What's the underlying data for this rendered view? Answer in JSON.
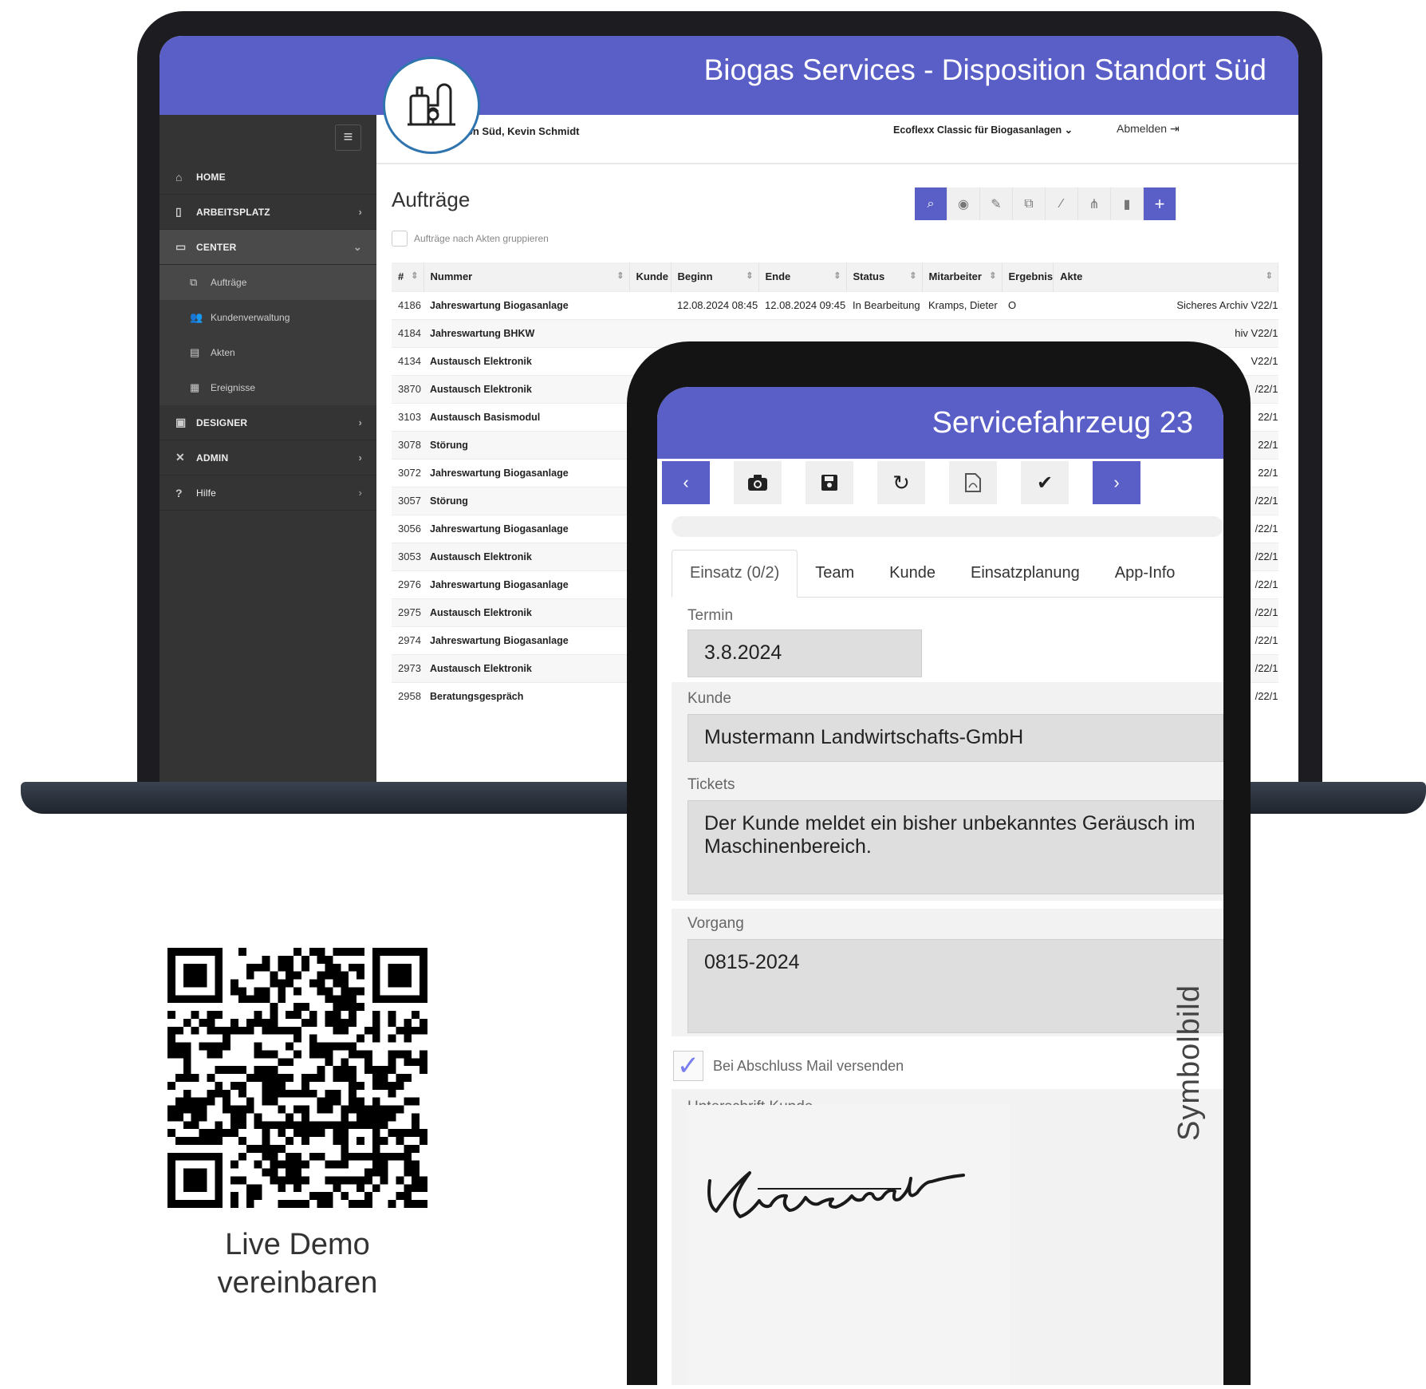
{
  "laptop": {
    "banner_title": "Biogas Services - Disposition Standort Süd",
    "user_info": "Disposition Süd, Kevin Schmidt",
    "product_selector": "Ecoflexx Classic für Biogasanlagen ⌄",
    "logout_label": "Abmelden",
    "sidebar": {
      "items": [
        {
          "label": "HOME",
          "icon": "home-icon"
        },
        {
          "label": "ARBEITSPLATZ",
          "icon": "mobile-icon"
        },
        {
          "label": "CENTER",
          "icon": "monitor-icon"
        },
        {
          "label": "Aufträge",
          "icon": "orders-icon"
        },
        {
          "label": "Kundenverwaltung",
          "icon": "users-icon"
        },
        {
          "label": "Akten",
          "icon": "archive-icon"
        },
        {
          "label": "Ereignisse",
          "icon": "events-icon"
        },
        {
          "label": "DESIGNER",
          "icon": "designer-icon"
        },
        {
          "label": "ADMIN",
          "icon": "tools-icon"
        },
        {
          "label": "Hilfe",
          "icon": "help-icon"
        }
      ]
    },
    "page_title": "Aufträge",
    "group_label": "Aufträge nach Akten gruppieren",
    "table": {
      "headers": [
        "#",
        "Nummer",
        "Kunde",
        "Beginn",
        "Ende",
        "Status",
        "Mitarbeiter",
        "Ergebnis",
        "Akte"
      ],
      "rows": [
        {
          "id": "4186",
          "title": "Jahreswartung Biogasanlage",
          "kunde": "",
          "beginn": "12.08.2024 08:45",
          "ende": "12.08.2024 09:45",
          "status": "In Bearbeitung",
          "mitarbeiter": "Kramps, Dieter",
          "ergebnis": "O",
          "akte": "Sicheres Archiv V22/1"
        },
        {
          "id": "4184",
          "title": "Jahreswartung BHKW",
          "akte": "hiv V22/1"
        },
        {
          "id": "4134",
          "title": "Austausch Elektronik",
          "akte": "V22/1"
        },
        {
          "id": "3870",
          "title": "Austausch Elektronik",
          "akte": "/22/1"
        },
        {
          "id": "3103",
          "title": "Austausch Basismodul",
          "akte": "22/1"
        },
        {
          "id": "3078",
          "title": "Störung",
          "akte": "22/1"
        },
        {
          "id": "3072",
          "title": "Jahreswartung Biogasanlage",
          "akte": "22/1"
        },
        {
          "id": "3057",
          "title": "Störung",
          "akte": "/22/1"
        },
        {
          "id": "3056",
          "title": "Jahreswartung Biogasanlage",
          "akte": "/22/1"
        },
        {
          "id": "3053",
          "title": "Austausch Elektronik",
          "akte": "/22/1"
        },
        {
          "id": "2976",
          "title": "Jahreswartung Biogasanlage",
          "akte": "/22/1"
        },
        {
          "id": "2975",
          "title": "Austausch Elektronik",
          "akte": "/22/1"
        },
        {
          "id": "2974",
          "title": "Jahreswartung Biogasanlage",
          "akte": "/22/1"
        },
        {
          "id": "2973",
          "title": "Austausch Elektronik",
          "akte": "/22/1"
        },
        {
          "id": "2958",
          "title": "Beratungsgespräch",
          "akte": "/22/1"
        }
      ]
    }
  },
  "tablet": {
    "title": "Servicefahrzeug 23",
    "tabs": [
      "Einsatz (0/2)",
      "Team",
      "Kunde",
      "Einsatzplanung",
      "App-Info"
    ],
    "termin_label": "Termin",
    "termin_value": "3.8.2024",
    "kunde_label": "Kunde",
    "kunde_value": "Mustermann Landwirtschafts-GmbH",
    "tickets_label": "Tickets",
    "tickets_value": "Der Kunde meldet ein bisher unbekanntes Geräusch im Maschinenbereich.",
    "vorgang_label": "Vorgang",
    "vorgang_value": "0815-2024",
    "mail_label": "Bei Abschluss Mail versenden",
    "mail_checked": true,
    "signature_label": "Unterschrift Kunde",
    "signature_text": "Unterschrift",
    "symbolbild": "Symbolbild"
  },
  "qr": {
    "caption_line1": "Live Demo",
    "caption_line2": "vereinbaren"
  },
  "colors": {
    "brand": "#5a5fc8",
    "sidebar": "#343434"
  }
}
